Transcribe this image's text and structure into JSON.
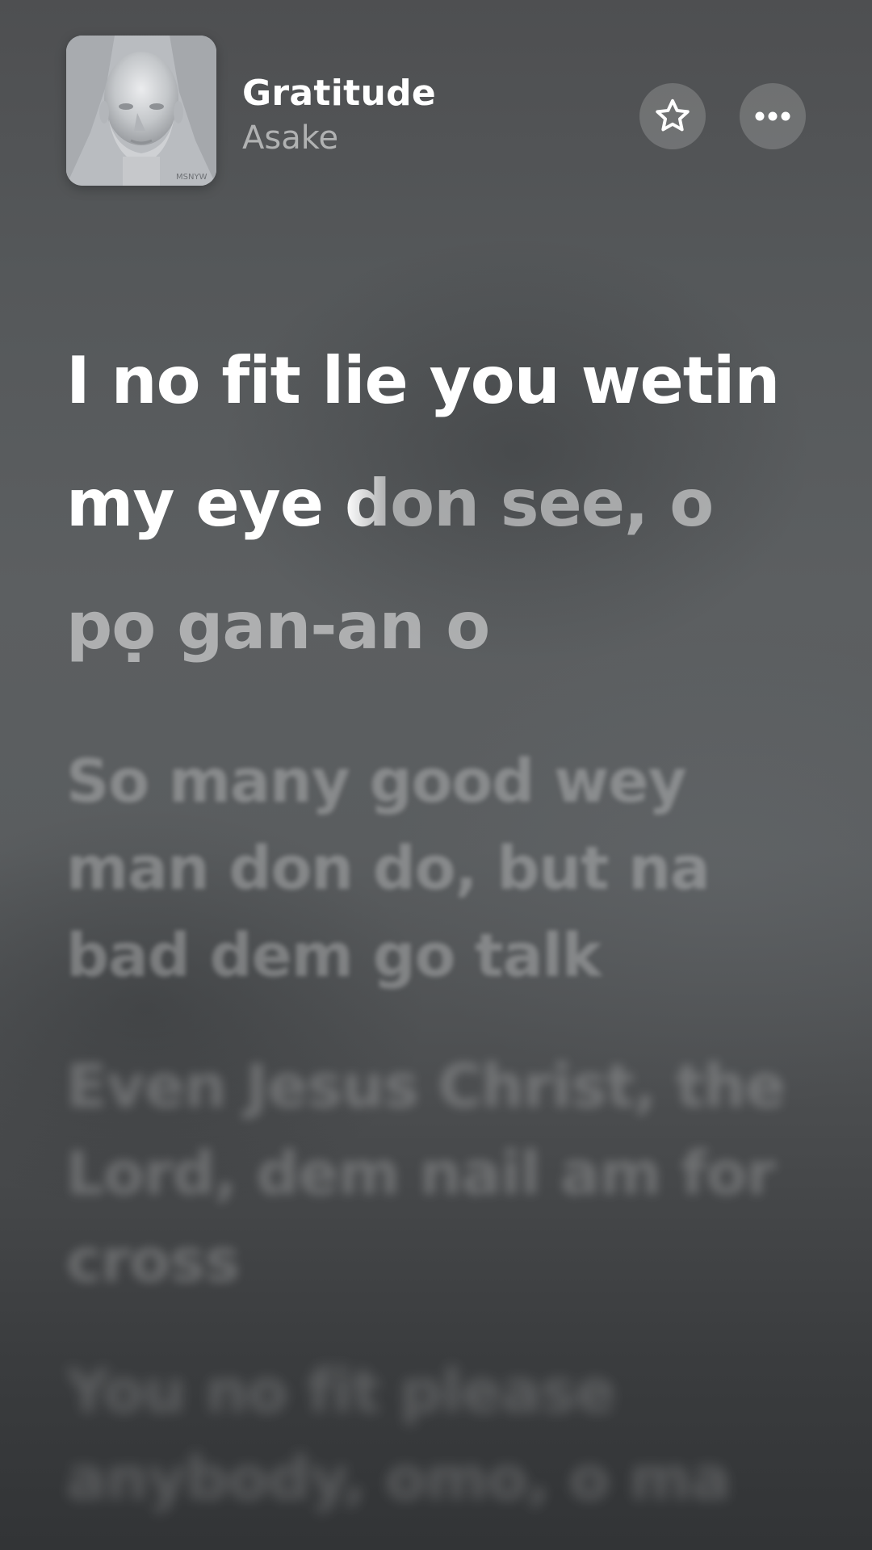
{
  "now_playing": {
    "title": "Gratitude",
    "artist": "Asake",
    "artwork_icon": "album-artwork-face-sculpture",
    "artwork_text": "MSNYW"
  },
  "actions": {
    "favorite_icon": "star-icon",
    "more_icon": "ellipsis-icon"
  },
  "lyrics": {
    "active": {
      "sung": "I no fit lie you wetin my eye ",
      "fade_char": "d",
      "unsung": "on see, o pọ gan-an o"
    },
    "upcoming": [
      "So many good wey man don do, but na bad dem go talk",
      "Even Jesus Christ, the Lord, dem nail am for cross",
      "You no fit please anybody, omo, o ma"
    ]
  },
  "colors": {
    "sung_text": "#FFFFFF",
    "unsung_text": "rgba(255,255,255,0.5)",
    "background": "#55585A"
  }
}
